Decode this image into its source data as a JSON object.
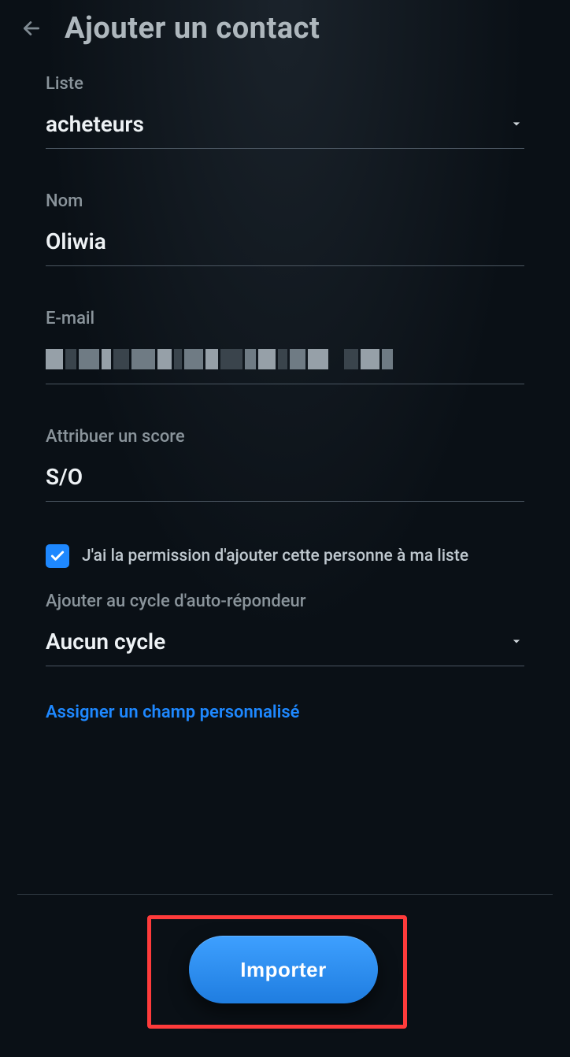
{
  "header": {
    "title": "Ajouter un contact"
  },
  "form": {
    "list": {
      "label": "Liste",
      "value": "acheteurs"
    },
    "name": {
      "label": "Nom",
      "value": "Oliwia"
    },
    "email": {
      "label": "E-mail",
      "value": ""
    },
    "score": {
      "label": "Attribuer un score",
      "value": "S/O"
    },
    "permission": {
      "checked": true,
      "label": "J'ai la permission d'ajouter cette personne à ma liste"
    },
    "autoresponder": {
      "label": "Ajouter au cycle d'auto-répondeur",
      "value": "Aucun cycle"
    },
    "custom_field_link": "Assigner un champ personnalisé"
  },
  "footer": {
    "import_label": "Importer"
  }
}
